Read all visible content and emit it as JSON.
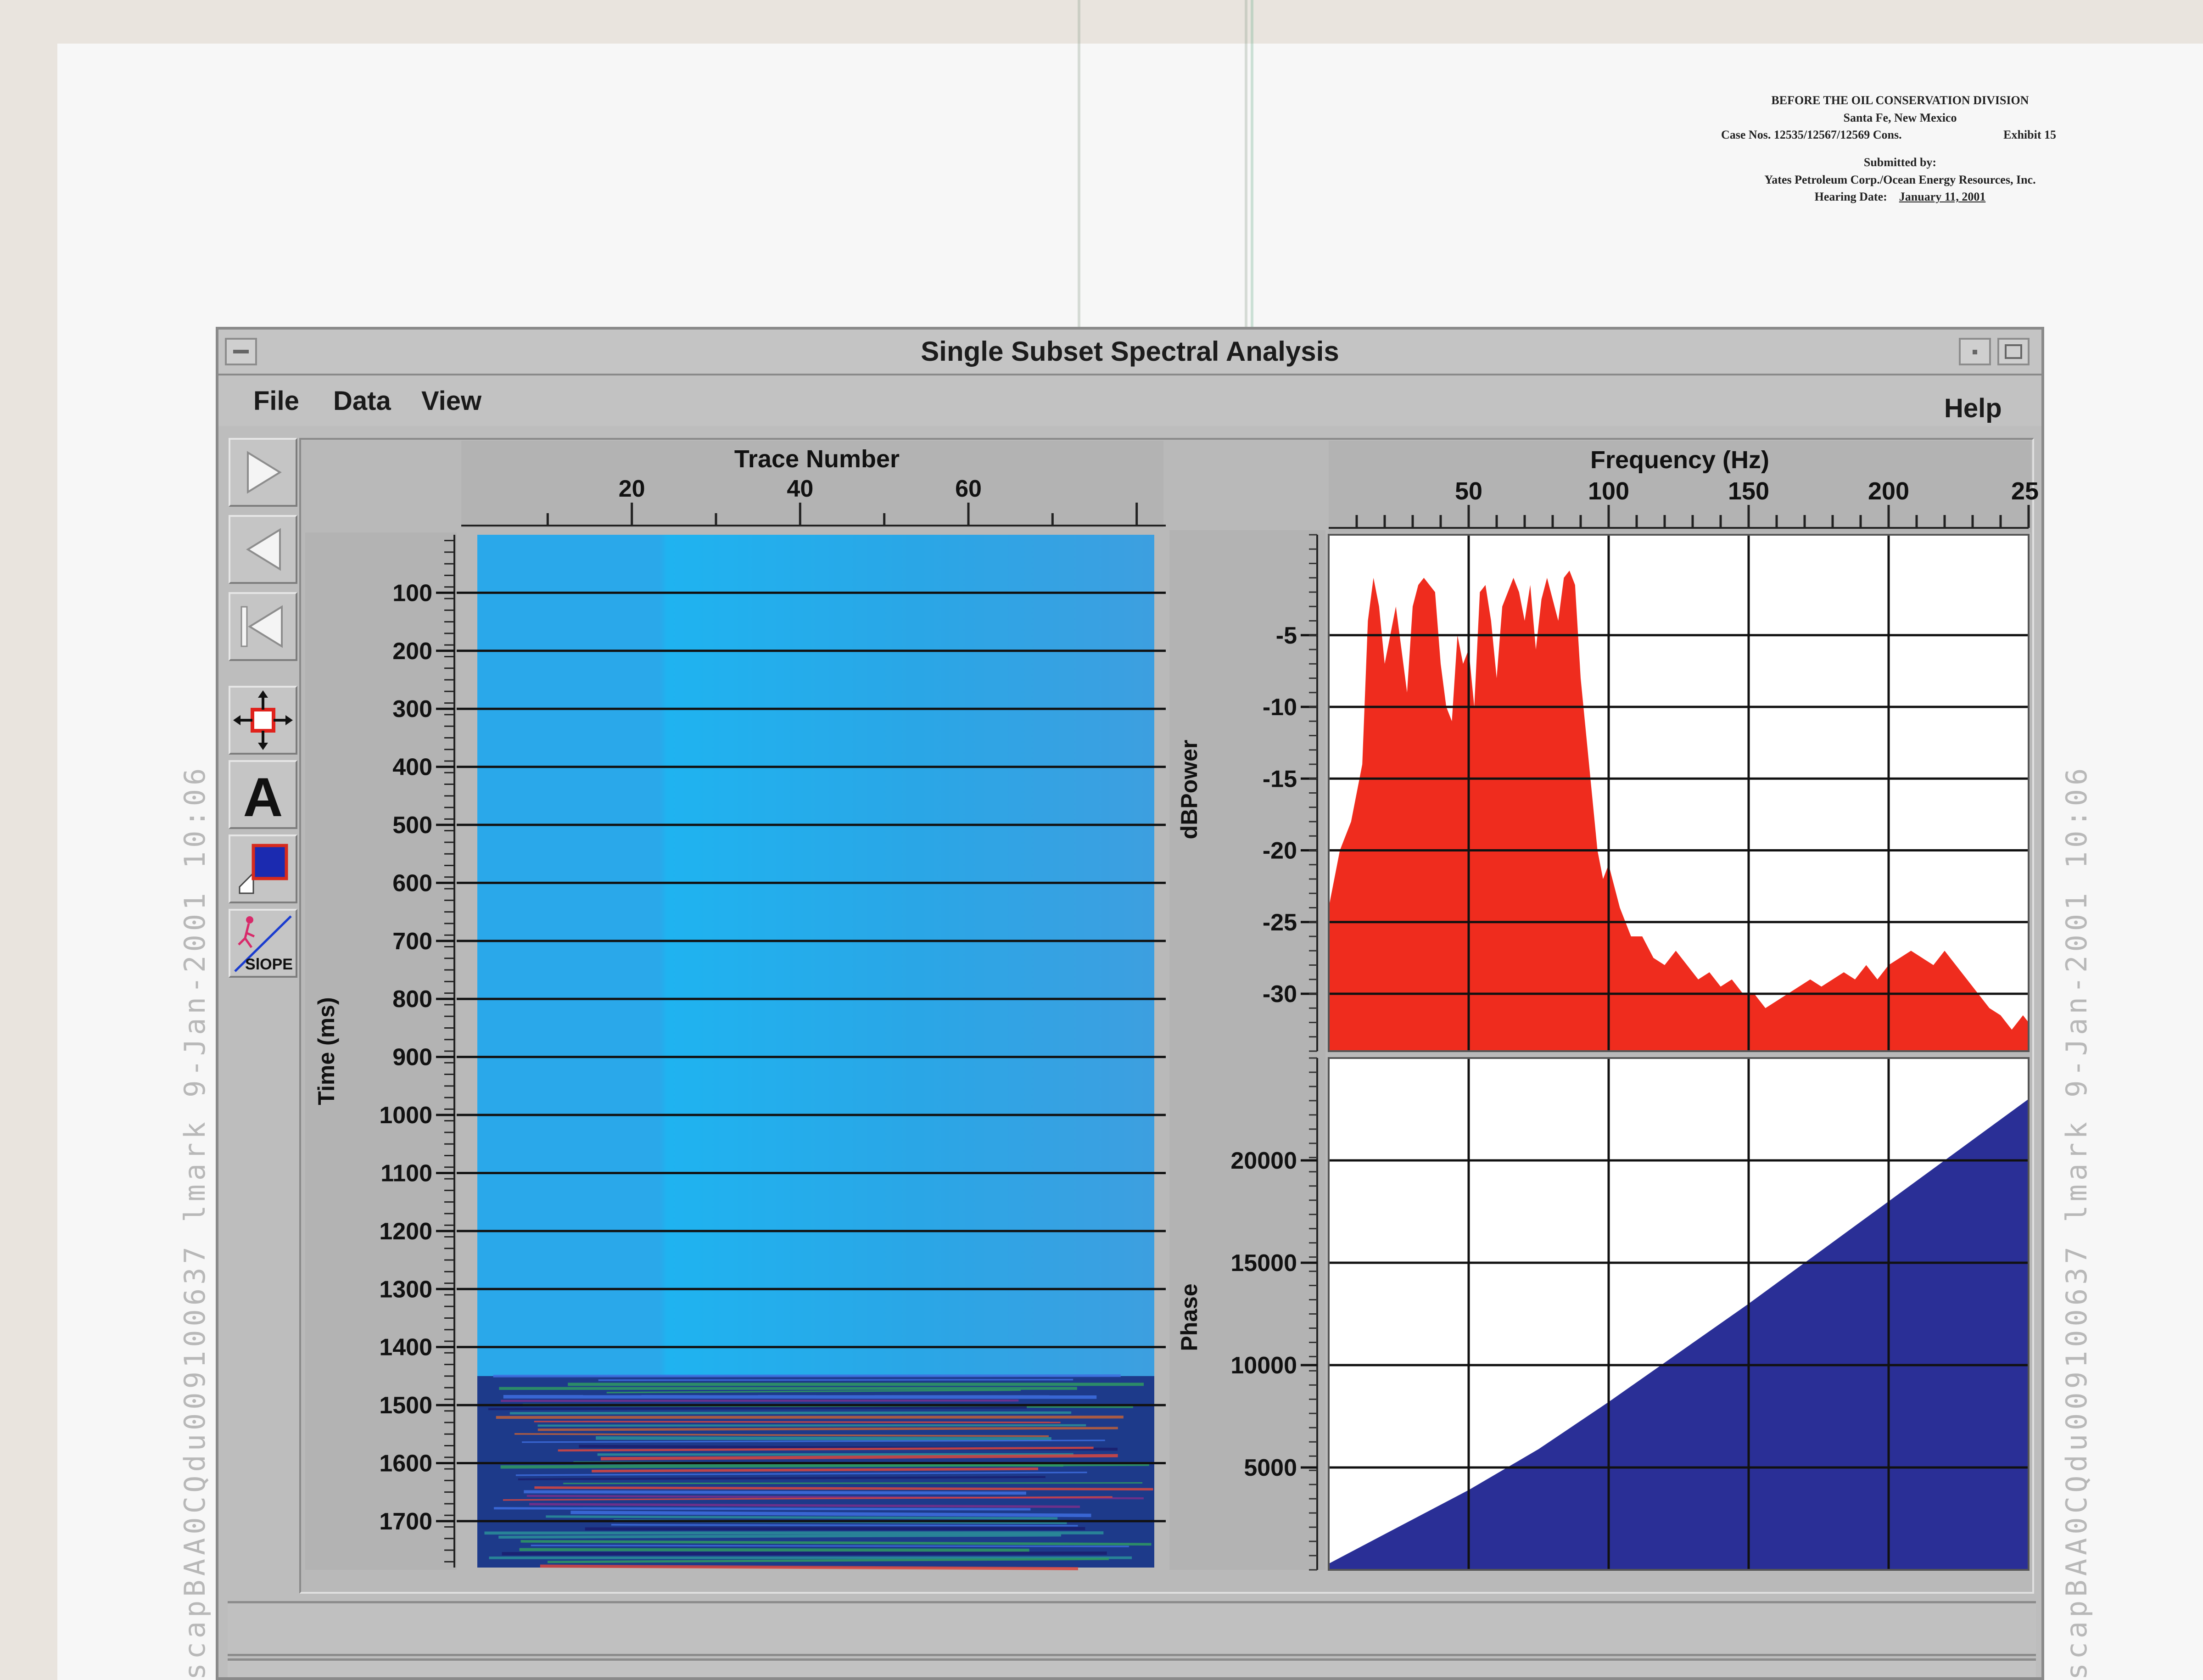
{
  "stamps": {
    "left": "scapBAA0CQdu009100637   lmark          9-Jan-2001   10:06",
    "right": "scapBAA0CQdu009100637   lmark          9-Jan-2001   10:06"
  },
  "exhibit_label": {
    "line1": "BEFORE THE OIL CONSERVATION DIVISION",
    "line2": "Santa Fe, New Mexico",
    "case_nos": "Case Nos. 12535/12567/12569 Cons.",
    "exhibit": "Exhibit   15",
    "submitted": "Submitted  by:",
    "company": "Yates Petroleum Corp./Ocean Energy Resources, Inc.",
    "hearing_label": "Hearing Date:",
    "hearing_date": "January 11, 2001"
  },
  "window": {
    "title": "Single Subset Spectral Analysis"
  },
  "menu": {
    "file": "File",
    "data": "Data",
    "view": "View",
    "help": "Help"
  },
  "toolbar": {
    "tools": [
      "play-forward-icon",
      "step-back-icon",
      "rewind-icon",
      "move-arrows-icon",
      "text-annotation-icon",
      "color-fill-icon",
      "slope-icon"
    ],
    "slope_label": "SlOPE"
  },
  "seismic": {
    "x_label": "Trace Number",
    "y_label": "Time (ms)",
    "x_ticks": [
      "20",
      "40",
      "60"
    ],
    "y_ticks": [
      "100",
      "200",
      "300",
      "400",
      "500",
      "600",
      "700",
      "800",
      "900",
      "1000",
      "1100",
      "1200",
      "1300",
      "1400",
      "1500",
      "1600",
      "1700"
    ],
    "data_start_ms": 1450
  },
  "chart_data": [
    {
      "type": "area",
      "ylabel": "dBPower",
      "xlabel": "Frequency (Hz)",
      "x_ticks": [
        "50",
        "100",
        "150",
        "200",
        "25"
      ],
      "y_ticks": [
        "-5",
        "-10",
        "-15",
        "-20",
        "-25",
        "-30"
      ],
      "xlim": [
        0,
        250
      ],
      "ylim": [
        -34,
        2
      ],
      "color": "#ef2c1e",
      "x": [
        0,
        4,
        8,
        12,
        14,
        16,
        18,
        20,
        22,
        24,
        26,
        28,
        30,
        32,
        34,
        36,
        38,
        40,
        42,
        44,
        46,
        48,
        50,
        52,
        54,
        56,
        58,
        60,
        62,
        64,
        66,
        68,
        70,
        72,
        74,
        76,
        78,
        80,
        82,
        84,
        86,
        88,
        90,
        92,
        94,
        96,
        98,
        100,
        104,
        108,
        112,
        116,
        120,
        124,
        128,
        132,
        136,
        140,
        144,
        148,
        152,
        156,
        160,
        164,
        168,
        172,
        176,
        180,
        184,
        188,
        192,
        196,
        200,
        204,
        208,
        212,
        216,
        220,
        224,
        228,
        232,
        236,
        240,
        244,
        248,
        250
      ],
      "y": [
        -24,
        -20,
        -18,
        -14,
        -4,
        -1,
        -3,
        -7,
        -5,
        -3,
        -6,
        -9,
        -3,
        -1.5,
        -1,
        -1.5,
        -2,
        -7,
        -10,
        -11,
        -5,
        -7,
        -6,
        -10,
        -2,
        -1.5,
        -4,
        -8,
        -3,
        -2,
        -1,
        -2,
        -4,
        -1.5,
        -6,
        -2.5,
        -1,
        -2.5,
        -4,
        -1,
        -0.5,
        -1.5,
        -8,
        -12,
        -16,
        -20,
        -22,
        -21,
        -24,
        -26,
        -26,
        -27.5,
        -28,
        -27,
        -28,
        -29,
        -28.5,
        -29.5,
        -29,
        -30,
        -30,
        -31,
        -30.5,
        -30,
        -29.5,
        -29,
        -29.5,
        -29,
        -28.5,
        -29,
        -28,
        -29,
        -28,
        -27.5,
        -27,
        -27.5,
        -28,
        -27,
        -28,
        -29,
        -30,
        -31,
        -31.5,
        -32.5,
        -31.5,
        -32
      ]
    },
    {
      "type": "area",
      "ylabel": "Phase",
      "xlabel": "Frequency (Hz)",
      "y_ticks": [
        "20000",
        "15000",
        "10000",
        "5000"
      ],
      "xlim": [
        0,
        250
      ],
      "ylim": [
        0,
        25000
      ],
      "color": "#2a2f96",
      "x": [
        0,
        25,
        50,
        75,
        100,
        125,
        150,
        175,
        200,
        225,
        250
      ],
      "y": [
        300,
        2100,
        3900,
        5900,
        8200,
        10600,
        13000,
        15500,
        18000,
        20500,
        23000
      ]
    }
  ]
}
